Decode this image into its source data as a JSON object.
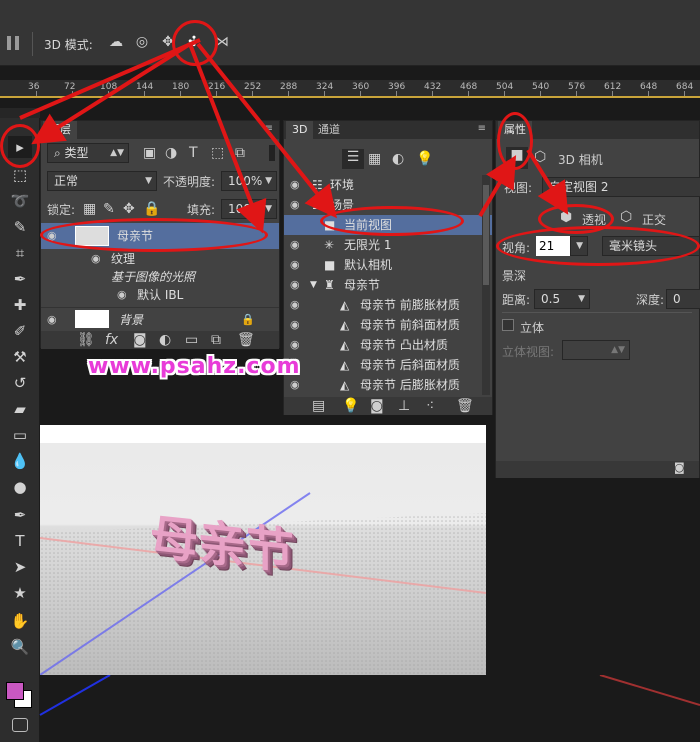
{
  "optbar": {
    "mode_label": "3D 模式:",
    "icons": [
      "rotate-3d-icon",
      "roll-3d-icon",
      "pan-3d-icon",
      "slide-3d-icon",
      "scale-3d-icon"
    ]
  },
  "ruler": {
    "ticks": [
      "36",
      "72",
      "108",
      "144",
      "180",
      "216",
      "252",
      "288",
      "324",
      "360",
      "396",
      "432",
      "468",
      "504",
      "540",
      "576",
      "612",
      "648",
      "684"
    ]
  },
  "layers": {
    "tab": "图层",
    "filter_kind": "类型",
    "blend_mode": "正常",
    "opacity_label": "不透明度:",
    "opacity_value": "100%",
    "lock_label": "锁定:",
    "fill_label": "填充:",
    "fill_value": "100%",
    "rows": [
      {
        "name": "母亲节"
      },
      {
        "name": "纹理"
      },
      {
        "name": "基于图像的光照"
      },
      {
        "name": "默认 IBL"
      },
      {
        "name": "背景"
      }
    ]
  },
  "panel3d": {
    "tabs": [
      "3D",
      "通道"
    ],
    "rows": [
      {
        "name": "环境"
      },
      {
        "name": "场景"
      },
      {
        "name": "当前视图"
      },
      {
        "name": "无限光 1"
      },
      {
        "name": "默认相机"
      },
      {
        "name": "母亲节"
      },
      {
        "name": "母亲节 前膨胀材质"
      },
      {
        "name": "母亲节 前斜面材质"
      },
      {
        "name": "母亲节 凸出材质"
      },
      {
        "name": "母亲节 后斜面材质"
      },
      {
        "name": "母亲节 后膨胀材质"
      }
    ]
  },
  "properties": {
    "tab": "属性",
    "header": "3D 相机",
    "view_label": "视图:",
    "view_value": "自定视图 2",
    "perspective_label": "透视",
    "ortho_label": "正交",
    "fov_label": "视角:",
    "fov_value": "21",
    "fov_unit": "毫米镜头",
    "dof_label": "景深",
    "distance_label": "距离:",
    "distance_value": "0.5",
    "depth_label": "深度:",
    "depth_value": "0",
    "stereo_label": "立体",
    "stereo_view_label": "立体视图:"
  },
  "watermark": "www.psahz.com",
  "canvas_text": "母亲节",
  "colors": {
    "foreground": "#c958c1",
    "background": "#ffffff",
    "annotation": "#e01616",
    "selection": "#546e9e"
  }
}
